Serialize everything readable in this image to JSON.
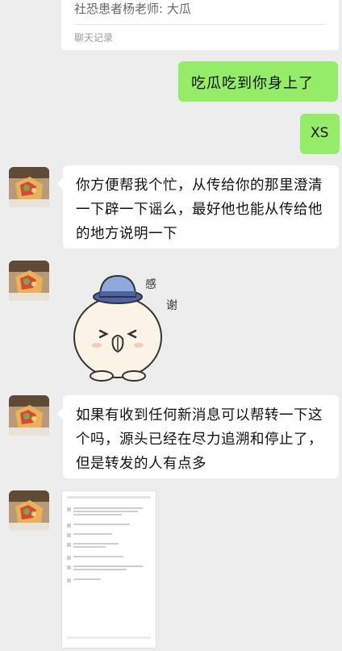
{
  "record_card": {
    "title": "社恐患者杨老师: 大瓜",
    "footer": "聊天记录"
  },
  "messages": {
    "out_1": "吃瓜吃到你身上了",
    "out_2": "XS",
    "in_1": "你方便帮我个忙，从传给你的那里澄清一下辟一下谣么，最好他也能从传给他的地方说明一下",
    "sticker_text_1": "感",
    "sticker_text_2": "谢",
    "in_2": "如果有收到任何新消息可以帮转一下这个吗，源头已经在尽力追溯和停止了，但是转发的人有点多"
  },
  "colors": {
    "background": "#ededed",
    "outgoing_bubble": "#95ec69",
    "incoming_bubble": "#ffffff"
  }
}
